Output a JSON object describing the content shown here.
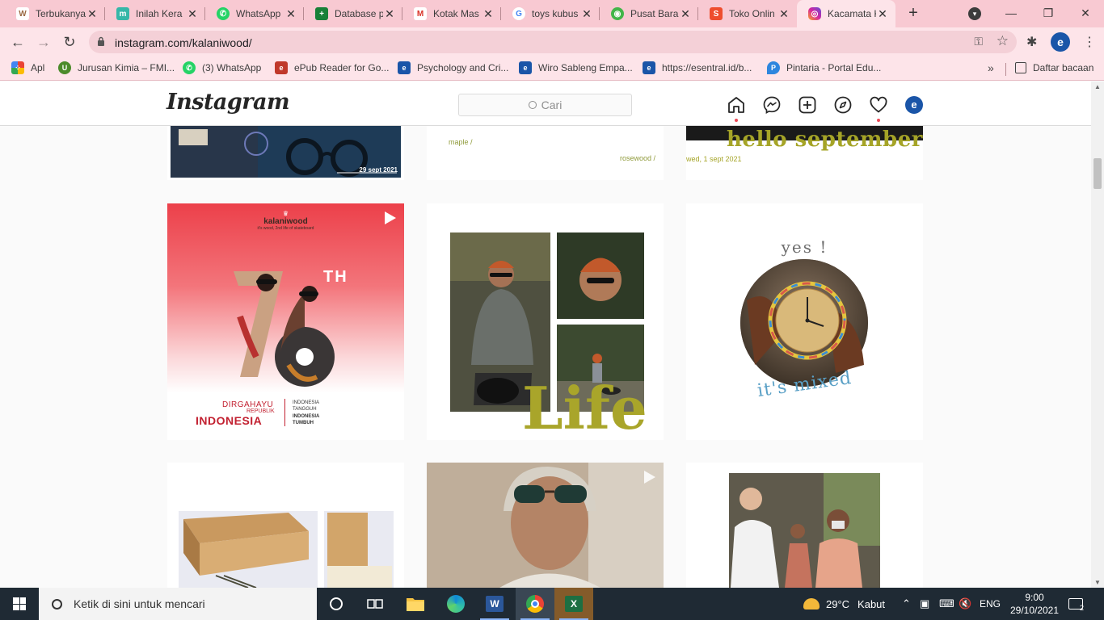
{
  "browser": {
    "tabs": [
      {
        "title": "Terbukanya",
        "icon": "tab-favicon-w",
        "favcolor": "#9b6a44",
        "favtext": "W"
      },
      {
        "title": "Inilah Kera",
        "icon": "tab-favicon-m",
        "favcolor": "#36b7a8",
        "favtext": "m"
      },
      {
        "title": "WhatsApp",
        "icon": "whatsapp-icon",
        "favcolor": "#25d366",
        "favtext": "✆"
      },
      {
        "title": "Database p",
        "icon": "google-sheets-icon",
        "favcolor": "#188038",
        "favtext": "+"
      },
      {
        "title": "Kotak Mas",
        "icon": "gmail-icon",
        "favcolor": "#ffffff",
        "favtext": "M"
      },
      {
        "title": "toys kubus",
        "icon": "google-icon",
        "favcolor": "#ffffff",
        "favtext": "G"
      },
      {
        "title": "Pusat Baran",
        "icon": "tokopedia-icon",
        "favcolor": "#42b549",
        "favtext": "◉"
      },
      {
        "title": "Toko Onlin",
        "icon": "shopee-icon",
        "favcolor": "#ee4d2d",
        "favtext": "S"
      },
      {
        "title": "Kacamata K",
        "icon": "instagram-icon",
        "favcolor": "#d6249f",
        "favtext": "◎"
      }
    ],
    "url": "instagram.com/kalaniwood/",
    "profile_initial": "e",
    "bookmarks": [
      {
        "label": "Apl",
        "icon": "apps-grid-icon",
        "color": "#e8453c"
      },
      {
        "label": "Jurusan Kimia – FMI...",
        "icon": "university-icon",
        "color": "#4c8b2b"
      },
      {
        "label": "(3) WhatsApp",
        "icon": "whatsapp-icon",
        "color": "#25d366"
      },
      {
        "label": "ePub Reader for Go...",
        "icon": "epub-reader-icon",
        "color": "#c0392b"
      },
      {
        "label": "Psychology and Cri...",
        "icon": "esentral-icon",
        "color": "#1a55a8"
      },
      {
        "label": "Wiro Sableng Empa...",
        "icon": "esentral-icon",
        "color": "#1a55a8"
      },
      {
        "label": "https://esentral.id/b...",
        "icon": "esentral-icon",
        "color": "#1a55a8"
      },
      {
        "label": "Pintaria - Portal Edu...",
        "icon": "pintaria-icon",
        "color": "#2e86de"
      }
    ],
    "reading_list": "Daftar bacaan"
  },
  "instagram": {
    "logo": "Instagram",
    "search_placeholder": "Cari",
    "avatar_initial": "e",
    "posts_row1": {
      "p1_date": "29 sept 2021",
      "p2_left": "maple /",
      "p2_right": "rosewood /",
      "p3_headline": "hello september",
      "p3_date": "wed, 1 sept 2021"
    },
    "posts_row2": {
      "p1_brand": "kalaniwood",
      "p1_tagline": "it's wood, 2nd life of skateboard",
      "p1_big": "76",
      "p1_th": "TH",
      "p1_line1": "DIRGAHAYU",
      "p1_line2": "REPUBLIK",
      "p1_line3": "INDONESIA",
      "p1_right1": "INDONESIA",
      "p1_right2": "TANGGUH",
      "p1_right3": "INDONESIA",
      "p1_right4": "TUMBUH",
      "p2_word": "Life",
      "p3_top": "yes !",
      "p3_bottom": "it's mixed"
    }
  },
  "taskbar": {
    "search_placeholder": "Ketik di sini untuk mencari",
    "weather_temp": "29°C",
    "weather_desc": "Kabut",
    "lang": "ENG",
    "time": "9:00",
    "date": "29/10/2021",
    "notif_count": "2"
  }
}
